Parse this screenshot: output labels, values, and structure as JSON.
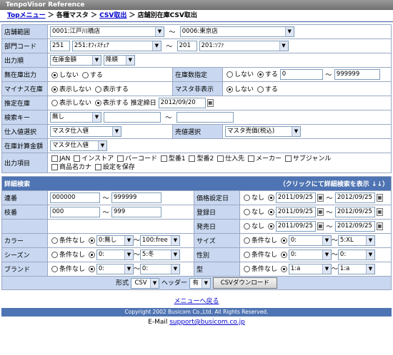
{
  "app_title": "TenpoVisor Reference",
  "breadcrumb": {
    "top": "Topメニュー",
    "sep1": " ＞ 各種マスタ ＞ ",
    "csv": "CSV取出",
    "sep2": " ＞ 店舗別在庫CSV取出"
  },
  "form": {
    "store_range": {
      "label": "店舗範囲",
      "from": "0001:江戸川橋店",
      "to": "0006:東京店"
    },
    "dept_code": {
      "label": "部門コード",
      "from_code": "251",
      "from_name": "251:ｵﾌｨｽﾁｪｱ",
      "to_code": "201",
      "to_name": "201:ｿﾌｧ"
    },
    "output_order": {
      "label": "出力順",
      "key": "在庫金額",
      "dir": "降順"
    },
    "no_stock": {
      "label": "無在庫出力",
      "off": "しない",
      "on": "する"
    },
    "stock_range": {
      "label": "在庫数指定",
      "off": "しない",
      "on": "する",
      "from": "0",
      "to": "999999"
    },
    "minus_stock": {
      "label": "マイナス在庫",
      "off": "表示しない",
      "on": "表示する"
    },
    "master_hidden": {
      "label": "マスタ非表示",
      "off": "しない",
      "on": "する"
    },
    "estimated_stock": {
      "label": "推定在庫",
      "off": "表示しない",
      "on": "表示する",
      "date_label": "推定締日",
      "date": "2012/09/20"
    },
    "search_key": {
      "label": "検索キー",
      "value": "無し"
    },
    "purchase_price": {
      "label": "仕入値選択",
      "value": "マスタ仕入値"
    },
    "sell_price": {
      "label": "売値選択",
      "value": "マスタ売価(税込)"
    },
    "stock_amount": {
      "label": "在庫計算金額",
      "value": "マスタ仕入値"
    },
    "output_items": {
      "label": "出力項目",
      "items": [
        "JAN",
        "インストア",
        "バーコード",
        "型番1",
        "型番2",
        "仕入先",
        "メーカー",
        "サブジャンル"
      ],
      "items2": [
        "商品名カナ",
        "設定を保存"
      ]
    }
  },
  "detail": {
    "title": "詳細検索",
    "toggle": "（クリックにて詳細検索を表示 ↓↓）",
    "renban": {
      "label": "連番",
      "from": "000000",
      "to": "999999"
    },
    "edaban": {
      "label": "枝番",
      "from": "000",
      "to": "999"
    },
    "price_set_date": {
      "label": "価格設定日",
      "none": "なし",
      "from": "2011/09/25",
      "to": "2012/09/25"
    },
    "reg_date": {
      "label": "登録日",
      "none": "なし",
      "from": "2011/09/25",
      "to": "2012/09/25"
    },
    "release_date": {
      "label": "発売日",
      "none": "なし",
      "from": "2011/09/25",
      "to": "2012/09/25"
    },
    "color": {
      "label": "カラー",
      "none": "条件なし",
      "from": "0:無し",
      "to": "100:free"
    },
    "size": {
      "label": "サイズ",
      "none": "条件なし",
      "from": "0:",
      "to": "5:XL"
    },
    "season": {
      "label": "シーズン",
      "none": "条件なし",
      "from": "0:",
      "to": "5:冬"
    },
    "gender": {
      "label": "性別",
      "none": "条件なし",
      "from": "0:",
      "to": "0:"
    },
    "brand": {
      "label": "ブランド",
      "none": "条件なし",
      "from": "0:",
      "to": "0:"
    },
    "model": {
      "label": "型",
      "none": "条件なし",
      "from": "1:a",
      "to": "1:a"
    }
  },
  "output": {
    "format_label": "形式",
    "format": "CSV",
    "header_label": "ヘッダー",
    "header": "有",
    "download": "CSVダウンロード"
  },
  "back_link": "メニューへ戻る",
  "copyright": "Copyright 2002 Busicom Co.,Ltd. All Rights Reserved.",
  "email_label": "E-Mail",
  "email": "support@busicom.co.jp"
}
